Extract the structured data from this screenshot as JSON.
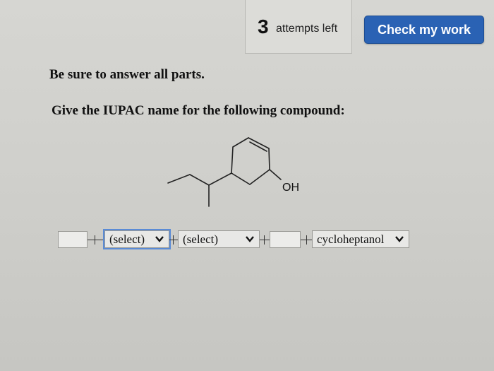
{
  "header": {
    "attempts_count": "3",
    "attempts_label": "attempts left",
    "check_button_label": "Check my work"
  },
  "question": {
    "instructions": "Be sure to answer all parts.",
    "prompt": "Give the IUPAC name for the following compound:",
    "structure_label": "OH"
  },
  "answer": {
    "select_1": "(select)",
    "select_2": "(select)",
    "select_3": "cycloheptanol"
  },
  "colors": {
    "accent": "#2a62b4",
    "focus": "#5a8bd6"
  }
}
